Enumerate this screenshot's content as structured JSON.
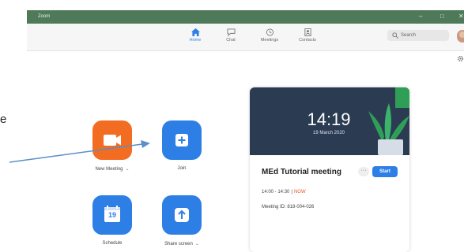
{
  "window": {
    "app_name": "Zoom",
    "minimize": "–",
    "maximize": "□",
    "close": "✕"
  },
  "toolbar": {
    "nav": [
      {
        "label": "Home",
        "icon": "home-icon",
        "active": true
      },
      {
        "label": "Chat",
        "icon": "chat-icon",
        "active": false
      },
      {
        "label": "Meetings",
        "icon": "clock-icon",
        "active": false
      },
      {
        "label": "Contacts",
        "icon": "contacts-icon",
        "active": false
      }
    ],
    "search_placeholder": "Search"
  },
  "side_text": "e",
  "actions": [
    {
      "label": "New Meeting",
      "chevron": "⌄",
      "icon": "video-camera-icon",
      "color": "#f26d21"
    },
    {
      "label": "Join",
      "chevron": "",
      "icon": "plus-icon",
      "color": "#2d7fe6"
    },
    {
      "label": "Schedule",
      "chevron": "",
      "icon": "calendar-icon",
      "calendar_day": "19",
      "color": "#2d7fe6"
    },
    {
      "label": "Share screen",
      "chevron": "⌄",
      "icon": "share-up-arrow-icon",
      "color": "#2d7fe6"
    }
  ],
  "meeting_card": {
    "time": "14:19",
    "date": "19 March 2020",
    "title": "MEd Tutorial meeting",
    "more": "···",
    "start_label": "Start",
    "time_range": "14:00 - 14:30",
    "separator": "|",
    "status": "NOW",
    "meeting_id": "Meeting ID: 818-004-026"
  },
  "colors": {
    "accent": "#2d7fe6",
    "orange": "#f26d21",
    "header_dark": "#2b3b52",
    "titlebar": "#4f7a5a",
    "annotation_arrow": "#5b8fc7"
  }
}
